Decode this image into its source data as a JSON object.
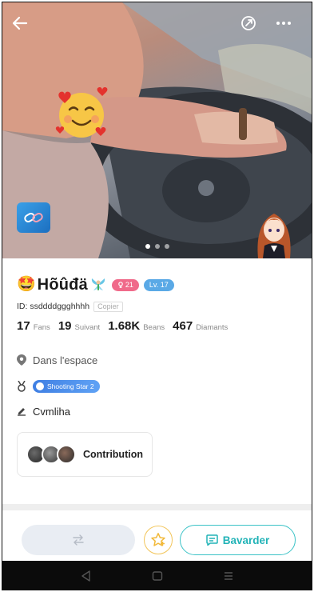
{
  "profile": {
    "name_emoji": "🤩",
    "name": "Hõûđä",
    "gender_badge": "21",
    "level_badge": "Lv. 17",
    "id_text": "ID: ssddddggghhhh",
    "copy_label": "Copier"
  },
  "stats": [
    {
      "value": "17",
      "label": "Fans"
    },
    {
      "value": "19",
      "label": "Suivant"
    },
    {
      "value": "1.68K",
      "label": "Beans"
    },
    {
      "value": "467",
      "label": "Diamants"
    }
  ],
  "location": "Dans l'espace",
  "medal_badge": "Shooting Star 2",
  "bio": "Cvmliha",
  "contribution_label": "Contribution",
  "carousel": {
    "count": 3,
    "active": 1
  },
  "actions": {
    "follow_icon": "swap-arrows-icon",
    "favorite_icon": "star-plus-icon",
    "chat_label": "Bavarder"
  },
  "colors": {
    "gender_pill": "#f06a8a",
    "level_pill": "#5aa9e6",
    "chat_accent": "#22b3b7",
    "favorite_accent": "#f2c55a"
  }
}
